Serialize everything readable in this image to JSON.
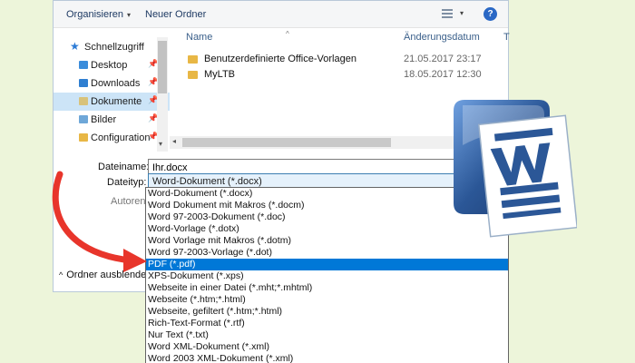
{
  "toolbar": {
    "organize_label": "Organisieren",
    "new_folder_label": "Neuer Ordner",
    "help_label": "?"
  },
  "nav": {
    "quick_access_label": "Schnellzugriff",
    "items": [
      {
        "label": "Desktop",
        "icon": "desktop-icon"
      },
      {
        "label": "Downloads",
        "icon": "download-folder-icon"
      },
      {
        "label": "Dokumente",
        "icon": "documents-folder-icon",
        "selected": true
      },
      {
        "label": "Bilder",
        "icon": "pictures-folder-icon"
      },
      {
        "label": "Configuration",
        "icon": "folder-icon"
      }
    ]
  },
  "file_list": {
    "columns": [
      "Name",
      "Änderungsdatum",
      "T"
    ],
    "rows": [
      {
        "name": "Benutzerdefinierte Office-Vorlagen",
        "date": "21.05.2017 23:17"
      },
      {
        "name": "MyLTB",
        "date": "18.05.2017 12:30"
      }
    ]
  },
  "form": {
    "filename_label": "Dateiname:",
    "filename_value": "Ihr.docx",
    "filetype_label": "Dateityp:",
    "filetype_value": "Word-Dokument (*.docx)",
    "authors_label": "Autoren:",
    "collapse_label": "Ordner ausblenden"
  },
  "filetype_options": [
    "Word-Dokument (*.docx)",
    "Word Dokument mit Makros (*.docm)",
    "Word 97-2003-Dokument (*.doc)",
    "Word-Vorlage (*.dotx)",
    "Word Vorlage mit Makros (*.dotm)",
    "Word 97-2003-Vorlage (*.dot)",
    "PDF (*.pdf)",
    "XPS-Dokument (*.xps)",
    "Webseite in einer Datei (*.mht;*.mhtml)",
    "Webseite (*.htm;*.html)",
    "Webseite, gefiltert (*.htm;*.html)",
    "Rich-Text-Format (*.rtf)",
    "Nur Text (*.txt)",
    "Word XML-Dokument (*.xml)",
    "Word 2003 XML-Dokument (*.xml)"
  ],
  "selected_option_index": 6,
  "colors": {
    "background": "#edf5da",
    "selection_blue": "#0078d7",
    "arrow_red": "#e8352b",
    "word_blue": "#2b5797"
  }
}
